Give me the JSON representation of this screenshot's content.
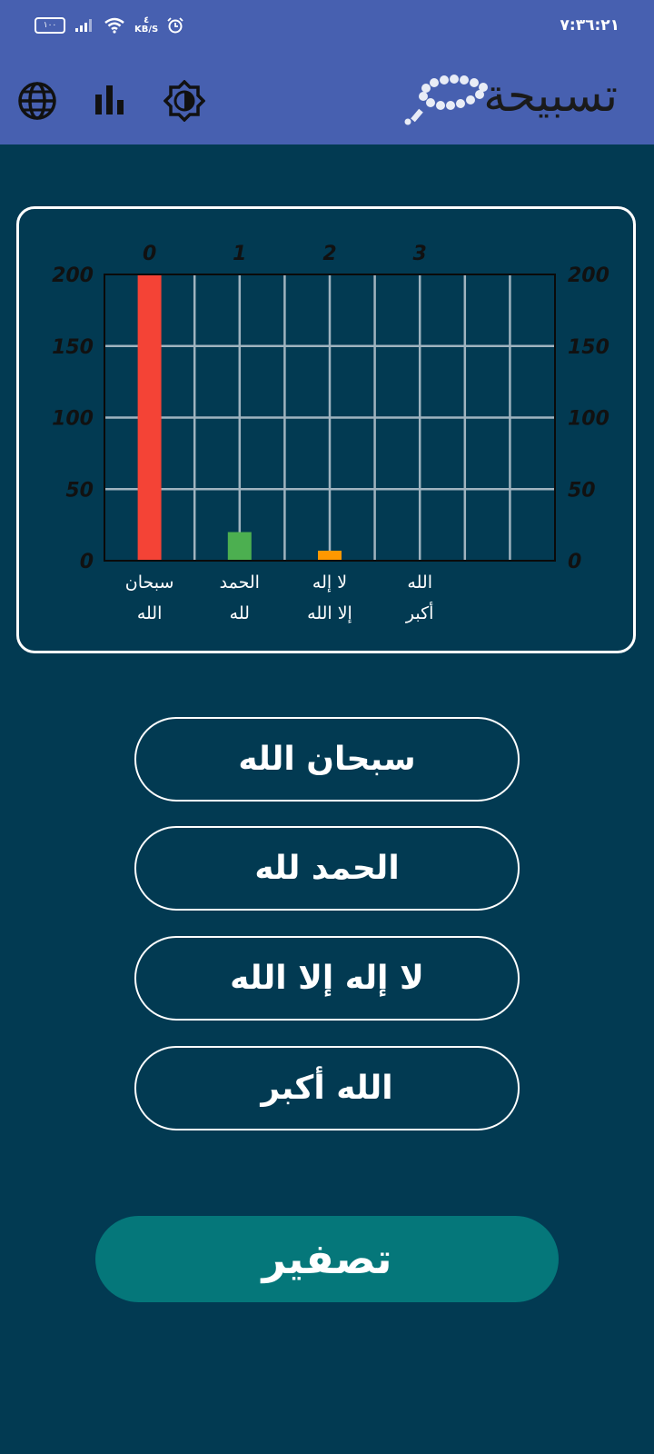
{
  "status_bar": {
    "battery": "١٠٠",
    "network_speed_value": "٤",
    "network_speed_unit": "KB/S",
    "time": "٧:٣٦:٢١"
  },
  "app_bar": {
    "title": "تسبيحة",
    "icons": [
      "globe-icon",
      "bar-chart-icon",
      "brightness-icon",
      "prayer-beads-icon"
    ]
  },
  "chart_data": {
    "type": "bar",
    "categories": [
      "سبحان الله",
      "الحمد لله",
      "لا إله إلا الله",
      "الله أكبر"
    ],
    "category_lines": [
      [
        "سبحان",
        "الله"
      ],
      [
        "الحمد",
        "لله"
      ],
      [
        "لا إله",
        "إلا الله"
      ],
      [
        "الله",
        "أكبر"
      ]
    ],
    "top_tick_labels": [
      "0",
      "1",
      "2",
      "3"
    ],
    "values": [
      200,
      20,
      7,
      0
    ],
    "colors": [
      "#f44336",
      "#4caf50",
      "#ff9800",
      "#2196f3"
    ],
    "ylim": [
      0,
      200
    ],
    "yticks": [
      "0",
      "50",
      "100",
      "150",
      "200"
    ],
    "grid": true
  },
  "buttons": {
    "subhanallah": "سبحان الله",
    "alhamdulillah": "الحمد لله",
    "la_ilaha": "لا إله إلا الله",
    "allahu_akbar": "الله أكبر",
    "reset": "تصفير"
  }
}
